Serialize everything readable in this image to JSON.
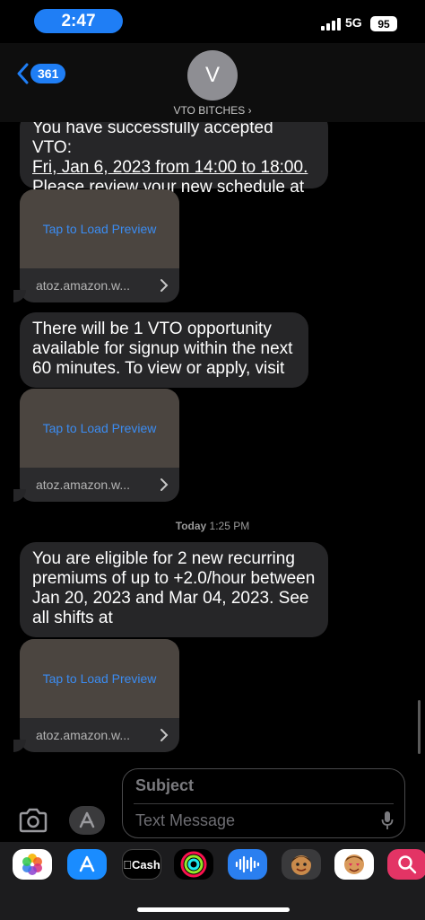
{
  "status_bar": {
    "time": "2:47",
    "network": "5G",
    "battery": "95"
  },
  "header": {
    "back_count": "361",
    "avatar_initial": "V",
    "contact_name": "VTO BITCHES ›"
  },
  "messages": [
    {
      "lines": [
        "You have successfully accepted VTO:",
        "Fri, Jan 6, 2023 from 14:00 to 18:00.",
        "Please review your new schedule at"
      ]
    },
    {
      "lines": [
        "There will be 1 VTO opportunity",
        "available for signup within the next",
        "60 minutes. To view or apply, visit"
      ]
    },
    {
      "lines": [
        "You are eligible for 2 new recurring",
        "premiums of up to +2.0/hour between",
        "Jan 20, 2023 and Mar 04, 2023. See",
        "all shifts at"
      ]
    }
  ],
  "link_preview": {
    "load_label": "Tap to Load Preview",
    "domain": "atoz.amazon.w..."
  },
  "timestamp": {
    "day": "Today",
    "time": "1:25 PM"
  },
  "compose": {
    "subject_placeholder": "Subject",
    "message_placeholder": "Text Message"
  },
  "app_strip": {
    "cash_label": "Cash",
    "apps": [
      "photos-icon",
      "app-store-icon",
      "apple-cash-icon",
      "activity-icon",
      "audio-message-icon",
      "memoji-icon",
      "memoji-stickers-icon",
      "search-images-icon"
    ]
  },
  "colors": {
    "accent_blue": "#1f7ef5",
    "bubble_gray": "#262628",
    "link_blue": "#3b8cf2"
  }
}
